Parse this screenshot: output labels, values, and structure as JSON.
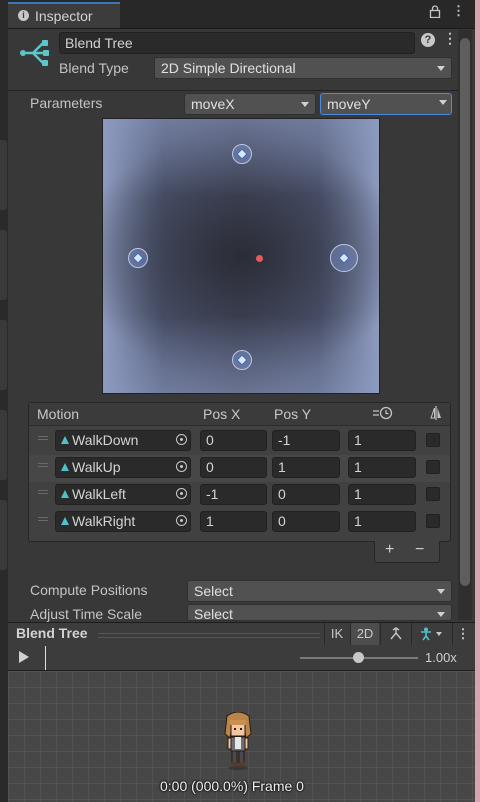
{
  "tab": {
    "title": "Inspector"
  },
  "header": {
    "name_value": "Blend Tree",
    "blend_type_label": "Blend Type",
    "blend_type_value": "2D Simple Directional"
  },
  "parameters": {
    "label": "Parameters",
    "param_x": "moveX",
    "param_y": "moveY"
  },
  "motion_table": {
    "headers": {
      "motion": "Motion",
      "pos_x": "Pos X",
      "pos_y": "Pos Y"
    },
    "rows": [
      {
        "motion": "WalkDown",
        "pos_x": "0",
        "pos_y": "-1",
        "speed": "1"
      },
      {
        "motion": "WalkUp",
        "pos_x": "0",
        "pos_y": "1",
        "speed": "1"
      },
      {
        "motion": "WalkLeft",
        "pos_x": "-1",
        "pos_y": "0",
        "speed": "1"
      },
      {
        "motion": "WalkRight",
        "pos_x": "1",
        "pos_y": "0",
        "speed": "1"
      }
    ],
    "add_label": "+",
    "remove_label": "−"
  },
  "settings": {
    "compute_positions_label": "Compute Positions",
    "compute_positions_value": "Select",
    "adjust_time_label": "Adjust Time Scale",
    "adjust_time_value": "Select"
  },
  "preview": {
    "title": "Blend Tree",
    "ik_label": "IK",
    "mode_label": "2D",
    "speed_value": "1.00x",
    "frame_info": "0:00 (000.0%) Frame 0"
  },
  "colors": {
    "accent": "#3a79bb",
    "clip_icon": "#4fc1c9",
    "center_dot": "#e85a5a"
  }
}
